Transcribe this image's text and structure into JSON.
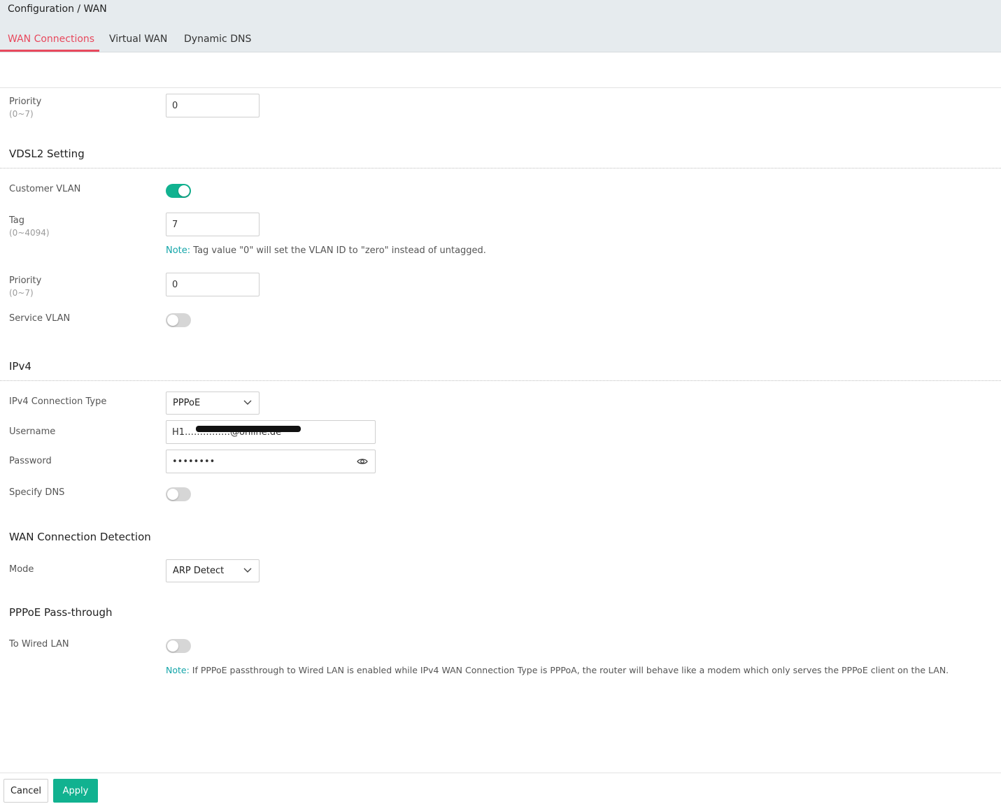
{
  "breadcrumb": "Configuration / WAN",
  "tabs": [
    {
      "label": "WAN Connections",
      "active": true
    },
    {
      "label": "Virtual WAN",
      "active": false
    },
    {
      "label": "Dynamic DNS",
      "active": false
    }
  ],
  "top_priority": {
    "label": "Priority",
    "range": "(0~7)",
    "value": "0"
  },
  "vdsl2": {
    "title": "VDSL2 Setting",
    "customer_vlan": {
      "label": "Customer VLAN",
      "enabled": true
    },
    "tag": {
      "label": "Tag",
      "range": "(0~4094)",
      "value": "7"
    },
    "tag_note": {
      "prefix": "Note:",
      "text": " Tag value \"0\" will set the VLAN ID to \"zero\" instead of untagged."
    },
    "priority": {
      "label": "Priority",
      "range": "(0~7)",
      "value": "0"
    },
    "service_vlan": {
      "label": "Service VLAN",
      "enabled": false
    }
  },
  "ipv4": {
    "title": "IPv4",
    "connection_type": {
      "label": "IPv4 Connection Type",
      "value": "PPPoE"
    },
    "username": {
      "label": "Username",
      "value": "H1……………@online.de"
    },
    "password": {
      "label": "Password",
      "value": "••••••••"
    },
    "specify_dns": {
      "label": "Specify DNS",
      "enabled": false
    }
  },
  "detection": {
    "title": "WAN Connection Detection",
    "mode": {
      "label": "Mode",
      "value": "ARP Detect"
    }
  },
  "passthrough": {
    "title": "PPPoE Pass-through",
    "to_wired_lan": {
      "label": "To Wired LAN",
      "enabled": false
    },
    "note": {
      "prefix": "Note:",
      "text": " If PPPoE passthrough to Wired LAN is enabled while IPv4 WAN Connection Type is PPPoA, the router will behave like a modem which only serves the PPPoE client on the LAN."
    }
  },
  "footer": {
    "cancel_label": "Cancel",
    "apply_label": "Apply"
  },
  "colors": {
    "accent_tab": "#e8495d",
    "toggle_on": "#11b290",
    "apply_button": "#11b290",
    "note_label": "#13a5a9"
  }
}
